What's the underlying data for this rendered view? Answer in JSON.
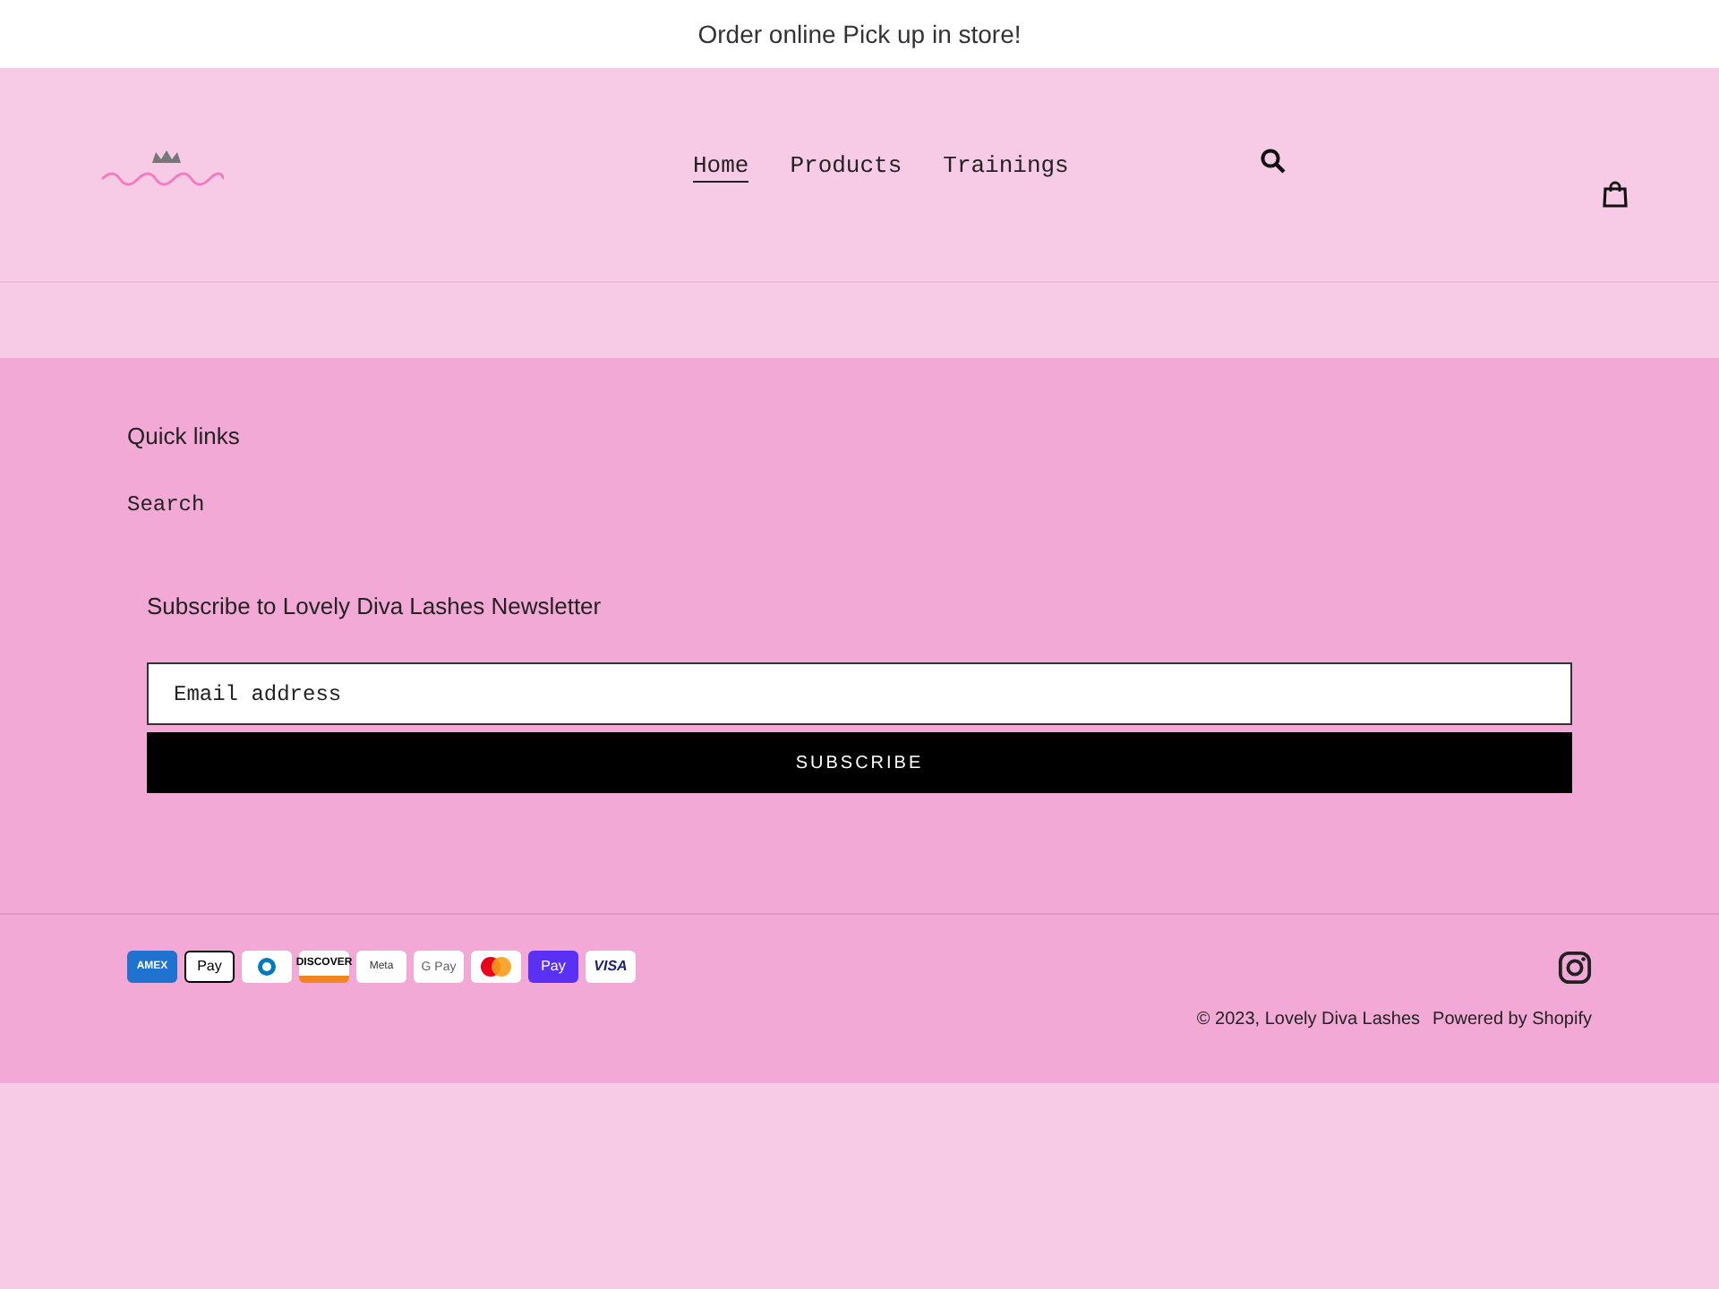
{
  "announcement": "Order online Pick up in store!",
  "nav": [
    {
      "label": "Home",
      "selected": true
    },
    {
      "label": "Products",
      "selected": false
    },
    {
      "label": "Trainings",
      "selected": false
    }
  ],
  "footer": {
    "heading": "Quick links",
    "links": [
      "Search"
    ],
    "newsletter": {
      "title": "Subscribe to Lovely Diva Lashes Newsletter",
      "placeholder": "Email address",
      "button": "SUBSCRIBE"
    },
    "payments": [
      {
        "kind": "amex",
        "label": "AMEX"
      },
      {
        "kind": "apple",
        "label": "Pay"
      },
      {
        "kind": "diners"
      },
      {
        "kind": "discover",
        "label": "DISCOVER"
      },
      {
        "kind": "meta",
        "label": "Meta"
      },
      {
        "kind": "gpay",
        "label": "G Pay"
      },
      {
        "kind": "master"
      },
      {
        "kind": "shop",
        "label": "Pay"
      },
      {
        "kind": "visa",
        "label": "VISA"
      }
    ],
    "copyright": "© 2023, Lovely Diva Lashes",
    "powered": "Powered by Shopify"
  }
}
